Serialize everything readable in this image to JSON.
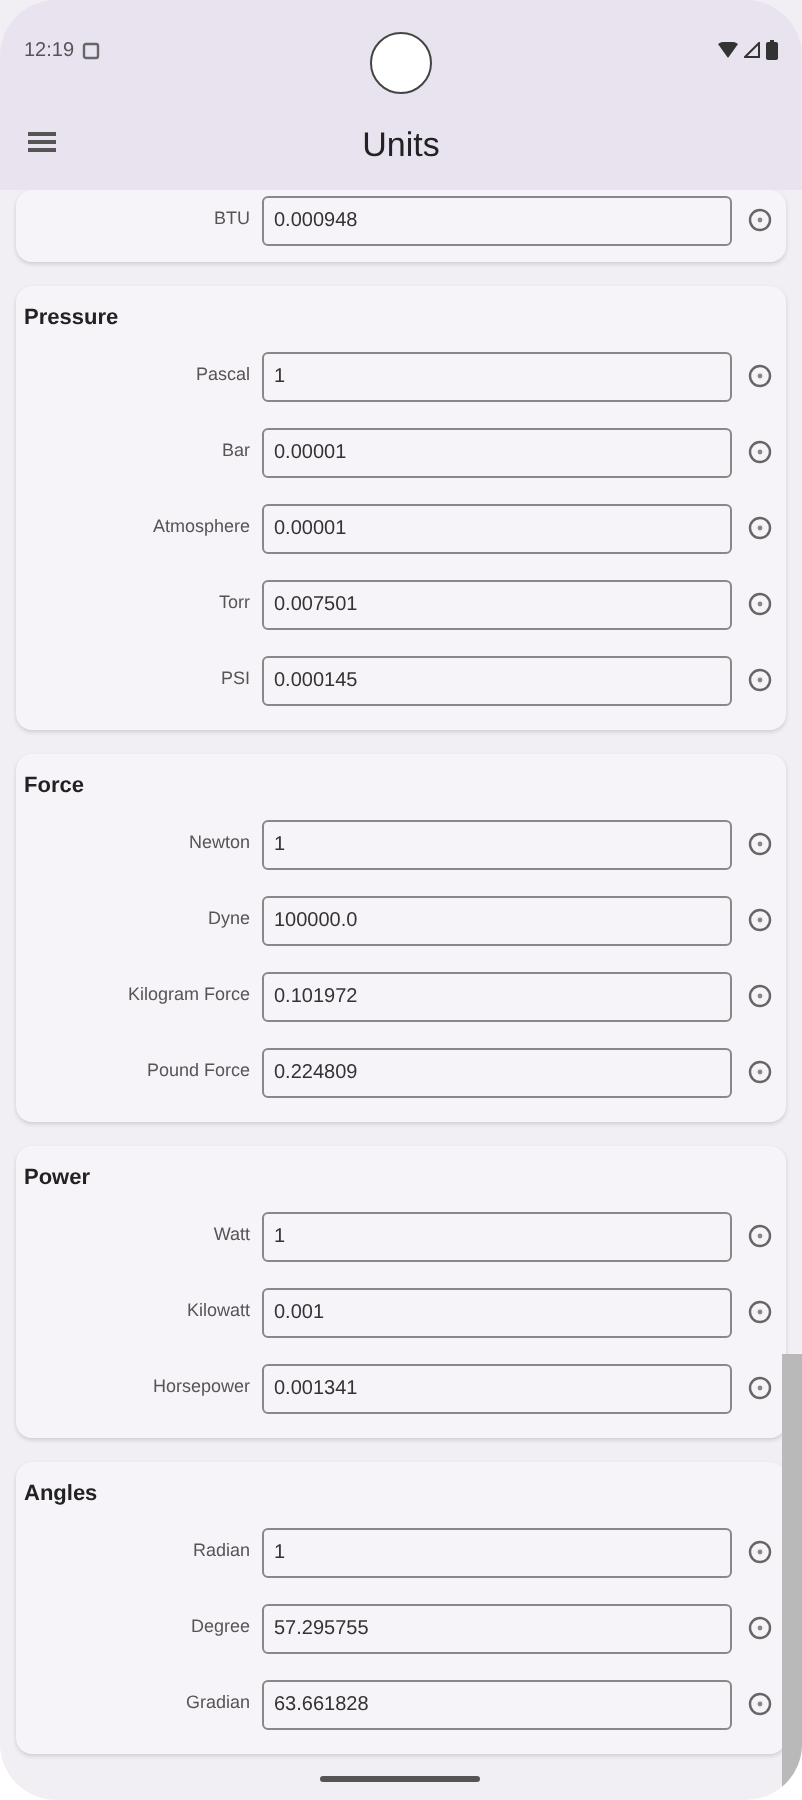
{
  "status_bar": {
    "time": "12:19"
  },
  "app_bar": {
    "title": "Units"
  },
  "sections": [
    {
      "rows": [
        {
          "label": "BTU",
          "value": "0.000948"
        }
      ]
    },
    {
      "title": "Pressure",
      "rows": [
        {
          "label": "Pascal",
          "value": "1"
        },
        {
          "label": "Bar",
          "value": "0.00001"
        },
        {
          "label": "Atmosphere",
          "value": "0.00001"
        },
        {
          "label": "Torr",
          "value": "0.007501"
        },
        {
          "label": "PSI",
          "value": "0.000145"
        }
      ]
    },
    {
      "title": "Force",
      "rows": [
        {
          "label": "Newton",
          "value": "1"
        },
        {
          "label": "Dyne",
          "value": "100000.0"
        },
        {
          "label": "Kilogram Force",
          "value": "0.101972"
        },
        {
          "label": "Pound Force",
          "value": "0.224809"
        }
      ]
    },
    {
      "title": "Power",
      "rows": [
        {
          "label": "Watt",
          "value": "1"
        },
        {
          "label": "Kilowatt",
          "value": "0.001"
        },
        {
          "label": "Horsepower",
          "value": "0.001341"
        }
      ]
    },
    {
      "title": "Angles",
      "rows": [
        {
          "label": "Radian",
          "value": "1"
        },
        {
          "label": "Degree",
          "value": "57.295755"
        },
        {
          "label": "Gradian",
          "value": "63.661828"
        }
      ]
    }
  ]
}
